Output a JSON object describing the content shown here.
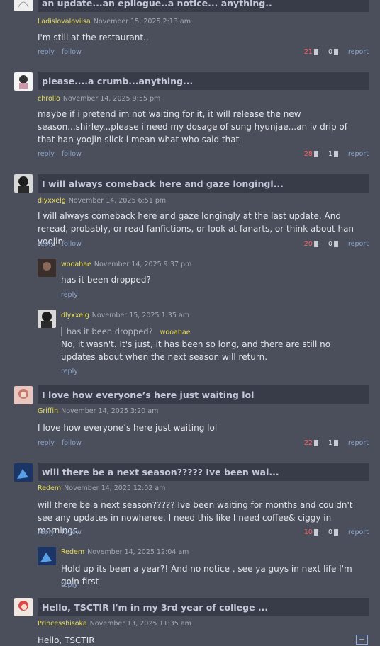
{
  "comments": [
    {
      "title": "an update...an epilogue..a notice... anything..",
      "user": "Ladislovaloviisa",
      "date": "November 15, 2025 2:13 am",
      "body": "I'm still at the restaurant..",
      "reply_label": "reply",
      "follow_label": "follow",
      "likes": "21",
      "dislikes": "0",
      "report_label": "report"
    },
    {
      "title": "please....a crumb...anything...",
      "user": "chrollo",
      "date": "November 14, 2025 9:55 pm",
      "body": "maybe if i pretend im not waiting for it, it will release the new season...shirley...please i need my dosage of sung hyunjae...an iv drip of that han yoojin slick i mean what who said that",
      "reply_label": "reply",
      "follow_label": "follow",
      "likes": "28",
      "dislikes": "1",
      "report_label": "report"
    },
    {
      "title": "I will always comeback here and gaze longingl...",
      "user": "dlyxxelg",
      "date": "November 14, 2025 6:51 pm",
      "body": "I will always comeback here and gaze longingly at the last update. And reread, probably, or read fanfictions, or look at fanarts, or think about han yoojin.",
      "reply_label": "reply",
      "follow_label": "follow",
      "likes": "20",
      "dislikes": "0",
      "report_label": "report",
      "replies": [
        {
          "user": "wooahae",
          "date": "November 14, 2025 9:37 pm",
          "body": "has it been dropped?",
          "reply_label": "reply"
        },
        {
          "user": "dlyxxelg",
          "date": "November 15, 2025 1:35 am",
          "quote": "has it been dropped?",
          "quote_author": "wooahae",
          "body": "No, it wasn't. It's just, it has been so long, and there are still no updates about when the next season will return.",
          "reply_label": "reply"
        }
      ]
    },
    {
      "title": "I love how everyone’s here just waiting lol",
      "user": "Griffin",
      "date": "November 14, 2025 3:20 am",
      "body": "I love how everyone’s here just waiting lol",
      "reply_label": "reply",
      "follow_label": "follow",
      "likes": "22",
      "dislikes": "1",
      "report_label": "report"
    },
    {
      "title": "will there be a next season????? Ive been wai...",
      "user": "Redem",
      "date": "November 14, 2025 12:02 am",
      "body": "will there be a next season????? Ive been waiting for months and couldn't see any updates in nowheree. I need this like I need coffee& ciggy in mornings.",
      "reply_label": "reply",
      "follow_label": "follow",
      "likes": "10",
      "dislikes": "0",
      "report_label": "report",
      "replies": [
        {
          "user": "Redem",
          "date": "November 14, 2025 12:04 am",
          "body": "Hold up its been a year?! And no notice , see ya guys in next life I'm goin first",
          "reply_label": "reply"
        }
      ]
    },
    {
      "title": "Hello, TSCTIR I'm in my 3rd year of college ...",
      "user": "Princesshisoka",
      "date": "November 13, 2025 11:35 am",
      "body": "Hello, TSCTIR"
    }
  ],
  "collapse_symbol": "−"
}
